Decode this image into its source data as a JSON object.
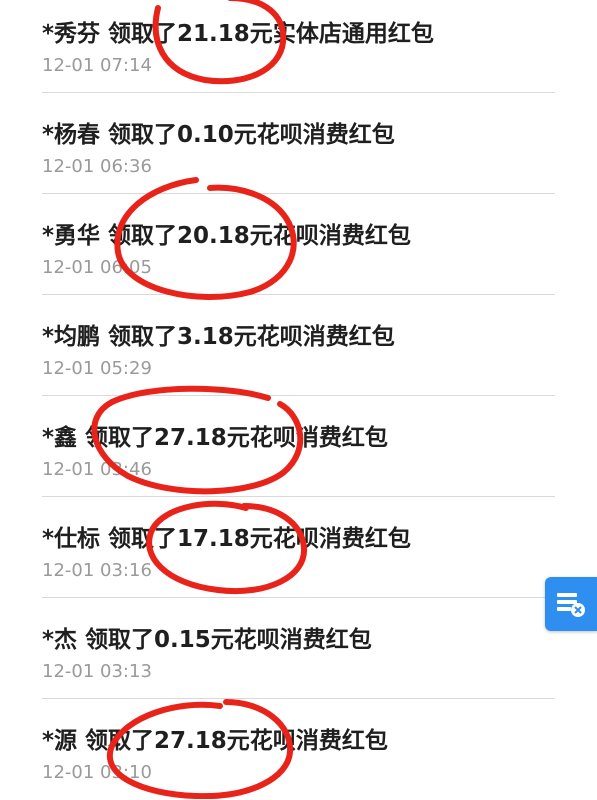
{
  "records": [
    {
      "name": "*秀芬",
      "action": "领取了",
      "amount": "21.18元",
      "type": "实体店通用红包",
      "time": "12-01 07:14"
    },
    {
      "name": "*杨春",
      "action": "领取了",
      "amount": "0.10元",
      "type": "花呗消费红包",
      "time": "12-01 06:36"
    },
    {
      "name": "*勇华",
      "action": "领取了",
      "amount": "20.18元",
      "type": "花呗消费红包",
      "time": "12-01 06:05"
    },
    {
      "name": "*均鹏",
      "action": "领取了",
      "amount": "3.18元",
      "type": "花呗消费红包",
      "time": "12-01 05:29"
    },
    {
      "name": "*鑫",
      "action": "领取了",
      "amount": "27.18元",
      "type": "花呗消费红包",
      "time": "12-01 03:46"
    },
    {
      "name": "*仕标",
      "action": "领取了",
      "amount": "17.18元",
      "type": "花呗消费红包",
      "time": "12-01 03:16"
    },
    {
      "name": "*杰",
      "action": "领取了",
      "amount": "0.15元",
      "type": "花呗消费红包",
      "time": "12-01 03:13"
    },
    {
      "name": "*源",
      "action": "领取了",
      "amount": "27.18元",
      "type": "花呗消费红包",
      "time": "12-01 03:10"
    }
  ],
  "side_button": {
    "icon": "shop-manage-icon",
    "color": "#2f8ff0"
  },
  "annotation_color": "#e8231a"
}
